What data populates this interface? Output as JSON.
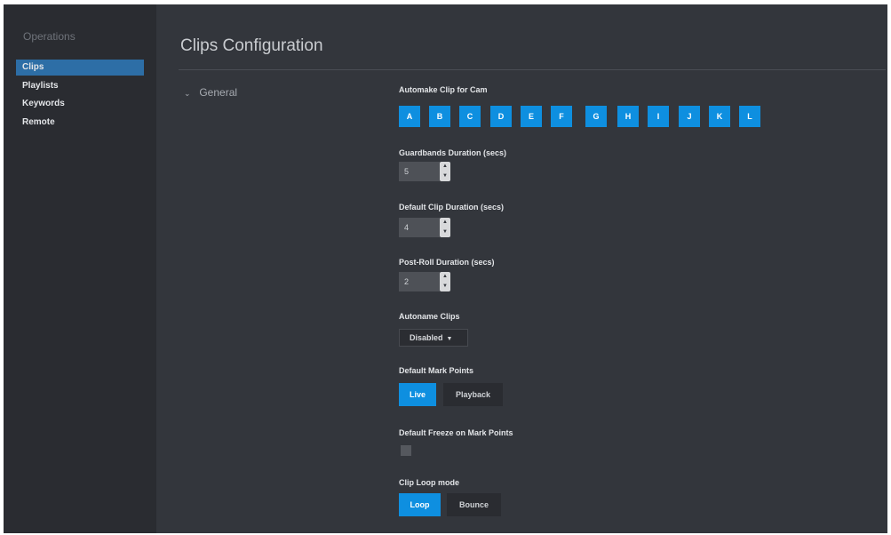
{
  "sidebar": {
    "heading": "Operations",
    "items": [
      {
        "label": "Clips"
      },
      {
        "label": "Playlists"
      },
      {
        "label": "Keywords"
      },
      {
        "label": "Remote"
      }
    ]
  },
  "header": {
    "title": "Clips Configuration"
  },
  "section": {
    "label": "General",
    "expanded": true
  },
  "automake": {
    "label": "Automake Clip for Cam",
    "cams": [
      "A",
      "B",
      "C",
      "D",
      "E",
      "F",
      "G",
      "H",
      "I",
      "J",
      "K",
      "L"
    ]
  },
  "guardbands": {
    "label": "Guardbands Duration (secs)",
    "value": "5"
  },
  "default_clip": {
    "label": "Default Clip Duration (secs)",
    "value": "4"
  },
  "post_roll": {
    "label": "Post-Roll Duration (secs)",
    "value": "2"
  },
  "autoname": {
    "label": "Autoname Clips",
    "selected": "Disabled"
  },
  "mark_points": {
    "label": "Default Mark Points",
    "options": [
      "Live",
      "Playback"
    ],
    "selected": "Live"
  },
  "freeze": {
    "label": "Default Freeze on Mark Points",
    "checked": false
  },
  "loop_mode": {
    "label": "Clip Loop mode",
    "options": [
      "Loop",
      "Bounce"
    ],
    "selected": "Loop"
  },
  "colors": {
    "accent": "#0e8fe0",
    "sidebar_active": "#2d6ea6",
    "background": "#33363c",
    "sidebar_bg": "#2a2c31"
  }
}
